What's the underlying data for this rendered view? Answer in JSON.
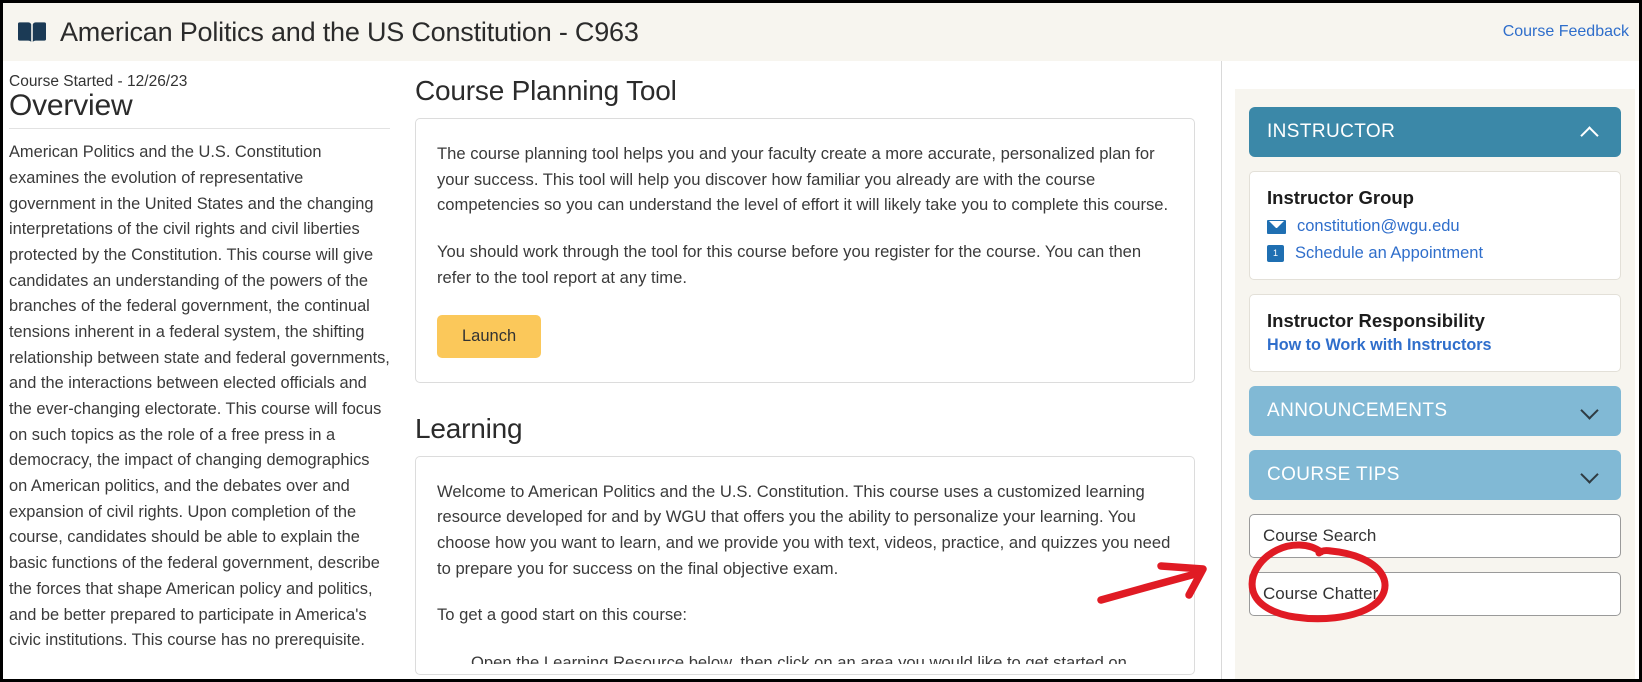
{
  "header": {
    "icon": "open-book-icon",
    "title": "American Politics and the US Constitution - C963",
    "feedback_link": "Course Feedback"
  },
  "left": {
    "course_started": "Course Started - 12/26/23",
    "overview_title": "Overview",
    "overview_text": "American Politics and the U.S. Constitution examines the evolution of representative government in the United States and the changing interpretations of the civil rights and civil liberties protected by the Constitution. This course will give candidates an understanding of the powers of the branches of the federal government, the continual tensions inherent in a federal system, the shifting relationship between state and federal governments, and the interactions between elected officials and the ever-changing electorate. This course will focus on such topics as the role of a free press in a democracy, the impact of changing demographics on American politics, and the debates over and expansion of civil rights. Upon completion of the course, candidates should be able to explain the basic functions of the federal government, describe the forces that shape American policy and politics, and be better prepared to participate in America's civic institutions. This course has no prerequisite."
  },
  "center": {
    "planning": {
      "heading": "Course Planning Tool",
      "paragraph1": "The course planning tool helps you and your faculty create a more accurate, personalized plan for your success. This tool will help you discover how familiar you already are with the course competencies so you can understand the level of effort it will likely take you to complete this course.",
      "paragraph2": "You should work through the tool for this course before you register for the course. You can then refer to the tool report at any time.",
      "launch_label": "Launch"
    },
    "learning": {
      "heading": "Learning",
      "paragraph1": "Welcome to American Politics and the U.S. Constitution. This course uses a customized learning resource developed for and by WGU that offers you the ability to personalize your learning. You choose how you want to learn, and we provide you with text, videos, practice, and quizzes you need to prepare you for success on the final objective exam.",
      "paragraph2": "To get a good start on this course:",
      "bullet_partial": "Open the Learning Resource below, then click on an area you would like to get started on."
    }
  },
  "sidebar": {
    "instructor_accordion": {
      "label": "INSTRUCTOR",
      "state": "expanded",
      "chevron": "chevron-up-icon"
    },
    "instructor_group": {
      "title": "Instructor Group",
      "email": "constitution@wgu.edu",
      "email_icon": "envelope-icon",
      "appointment": "Schedule an Appointment",
      "appointment_icon": "calendar-icon"
    },
    "instructor_responsibility": {
      "title": "Instructor Responsibility",
      "link": "How to Work with Instructors"
    },
    "announcements_accordion": {
      "label": "ANNOUNCEMENTS",
      "state": "collapsed",
      "chevron": "chevron-down-icon"
    },
    "course_tips_accordion": {
      "label": "COURSE TIPS",
      "state": "collapsed",
      "chevron": "chevron-down-icon"
    },
    "course_search": {
      "value": "Course Search",
      "placeholder": "Course Search"
    },
    "course_chatter": {
      "value": "Course Chatter",
      "placeholder": "Course Chatter"
    }
  },
  "annotation": {
    "color": "#e01b24",
    "shapes": "arrow-pointing-right and hand-drawn-ellipse around course-search"
  },
  "colors": {
    "header_bg": "#f7f5ef",
    "accent_teal": "#3b88a8",
    "accent_light_blue": "#81b9d5",
    "launch_amber": "#fbc85a",
    "link_blue": "#2f6ecb",
    "annotation_red": "#e01b24"
  }
}
